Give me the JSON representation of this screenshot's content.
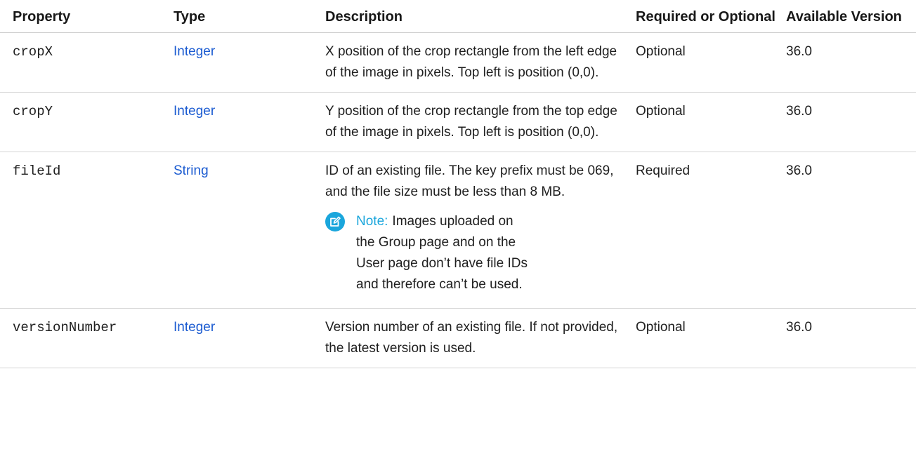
{
  "headers": {
    "property": "Property",
    "type": "Type",
    "description": "Description",
    "required": "Required or Optional",
    "version": "Available Version"
  },
  "rows": [
    {
      "property": "cropX",
      "type": "Integer",
      "description": "X position of the crop rectangle from the left edge of the image in pixels. Top left is position (0,0).",
      "required": "Optional",
      "version": "36.0"
    },
    {
      "property": "cropY",
      "type": "Integer",
      "description": "Y position of the crop rectangle from the top edge of the image in pixels. Top left is position (0,0).",
      "required": "Optional",
      "version": "36.0"
    },
    {
      "property": "fileId",
      "type": "String",
      "description": "ID of an existing file. The key prefix must be 069, and the file size must be less than 8 MB.",
      "note_label": "Note:",
      "note_text": "Images uploaded on the Group page and on the User page don’t have file IDs and therefore can’t be used.",
      "required": "Required",
      "version": "36.0"
    },
    {
      "property": "versionNumber",
      "type": "Integer",
      "description": "Version number of an existing file. If not provided, the latest version is used.",
      "required": "Optional",
      "version": "36.0"
    }
  ],
  "icons": {
    "note": "edit-note-icon"
  },
  "colors": {
    "link": "#1b5bd1",
    "note_accent": "#1aa6dc",
    "rule": "#d4d4d4"
  }
}
